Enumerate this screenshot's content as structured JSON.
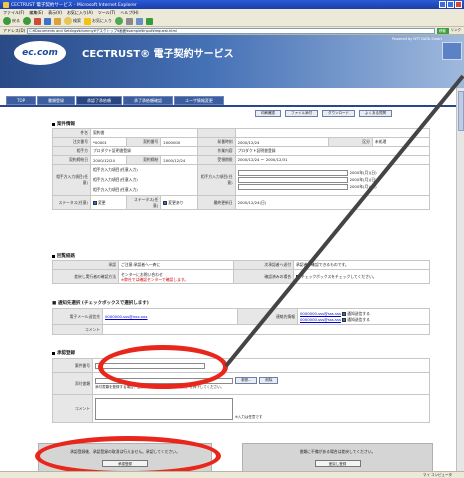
{
  "window": {
    "title": "CECTRUST 電子契約サービス - Microsoft Internet Explorer"
  },
  "menu": [
    "ファイル(F)",
    "編集(E)",
    "表示(V)",
    "お気に入り(A)",
    "ツール(T)",
    "ヘルプ(H)"
  ],
  "toolbar": {
    "back": "戻る",
    "search": "検索",
    "favorites": "お気に入り"
  },
  "address": {
    "label": "アドレス(D)",
    "url": "C:¥Documents and Settings¥dummy¥デスクトップ¥画面¥sample¥input¥request.html",
    "go": "移動",
    "links": "リンク"
  },
  "header": {
    "logo": "ec.com",
    "title": "CECTRUST® 電子契約サービス",
    "powered": "Powered by NTT DATA Smart"
  },
  "tabs": [
    "TOP",
    "書類登録",
    "承認了承依頼",
    "承了承依頼確認",
    "ユーザ情報変更"
  ],
  "actions": [
    "印刷確認",
    "ファイル添付",
    "ダウンロード",
    "よくある質問"
  ],
  "sections": {
    "contract": "案件情報",
    "flow": "回覧経路",
    "notify": "通知先",
    "register": "承認登録"
  },
  "contract": {
    "rows": [
      {
        "label": "件名",
        "value": "契約書"
      },
      {
        "label": "注文番号",
        "value": "*00001",
        "label2": "契約番号",
        "value2": "2000000",
        "label3": "発番時刻",
        "value3": "2000/12/24",
        "label4": "区分",
        "value4": "未処理"
      },
      {
        "label": "相手方",
        "value": "プロダクト証明書登録",
        "label2": "作業内容",
        "value2": "プロダクト証明書登録"
      },
      {
        "label": "契約締結日",
        "value": "2000/12/24",
        "label2": "契約締結",
        "value2": "2000/12/24",
        "label3": "受領期限",
        "value3": "2000/12/24 ～ 2000/12/31"
      },
      {
        "label": "相手方入力項目(任意)",
        "value": "相手方入力項目(任意入力)",
        "label2": "相手方入力項目(任意)",
        "value2": "2000年(月)(日)"
      },
      {
        "label": "ステータス(任意)",
        "value": "変更",
        "label2": "ステータス(任意)",
        "value2": "変更あり",
        "label3": "最終更新日",
        "value3": "2000/12/24(日)"
      }
    ]
  },
  "flow": {
    "row1_label": "承認",
    "row1_value": "ご注意:承認者へ一斉に",
    "row1_label2": "次承認者へ送付",
    "row1_value2": "承認者が確認できるものです。",
    "row2_label": "差戻し実行者の確認方法",
    "row2_value": "センターにお問い合わせ",
    "row2_note": "※弊社では確認センターで確認します。",
    "row2_label2": "確認済みの場合",
    "row2_value2": "チェックボックスをチェックしてください。"
  },
  "notify": {
    "intro": "■ 通知先選択 (チェックボックスで選択します)",
    "email_label": "電子メール送信先",
    "email_value": "0000000.sss@xxx.xxx",
    "contact_label": "連絡先情報",
    "contacts": [
      "0000000.sss@sss.sss",
      "0000000.sss@sss.sss"
    ],
    "contact_notes": [
      "通知送信する",
      "通知送信する"
    ],
    "comment_label": "コメント"
  },
  "register": {
    "id_label": "案件番号",
    "file_label": "添付書類",
    "browse": "参照...",
    "remove": "削除",
    "file_note": "添付書類を登録する場合、登録ファイルを選択して「参照」を押下してください。",
    "comment_label": "コメント",
    "comment_note": "※入力は任意です"
  },
  "bottom": {
    "left_msg": "承認登録後、承認登録の取消は行えません。承認してください。",
    "left_btn": "承認登録",
    "right_msg": "書類に不備がある場合は差戻してください。",
    "right_btn": "差戻し登録"
  },
  "status": "マイ コンピュータ",
  "colors": {
    "annotation": "#e8261b",
    "header_dark": "#294a86",
    "header_light": "#9fb9dd",
    "tab": "#3d5e9e"
  }
}
